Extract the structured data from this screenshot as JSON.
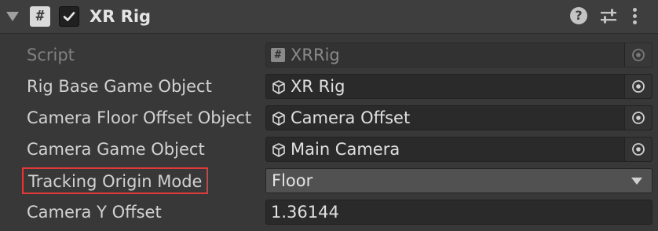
{
  "header": {
    "script_icon": "hash-icon",
    "script_glyph": "#",
    "enabled": true,
    "title": "XR Rig",
    "help_glyph": "?",
    "icons": [
      "help-icon",
      "presets-icon",
      "context-menu-icon"
    ]
  },
  "fields": [
    {
      "label": "Script",
      "value": "XRRig",
      "type": "script-reference",
      "disabled": true,
      "icon": "script-icon"
    },
    {
      "label": "Rig Base Game Object",
      "value": "XR Rig",
      "type": "object-reference",
      "icon": "gameobject-icon"
    },
    {
      "label": "Camera Floor Offset Object",
      "value": "Camera Offset",
      "type": "object-reference",
      "icon": "gameobject-icon"
    },
    {
      "label": "Camera Game Object",
      "value": "Main Camera",
      "type": "object-reference",
      "icon": "gameobject-icon"
    },
    {
      "label": "Tracking Origin Mode",
      "value": "Floor",
      "type": "dropdown",
      "highlighted": true
    },
    {
      "label": "Camera Y Offset",
      "value": "1.36144",
      "type": "float"
    }
  ],
  "colors": {
    "background": "#383838",
    "header_background": "#3e3e3e",
    "field_background": "#2a2a2a",
    "dropdown_background": "#515151",
    "highlight_border": "#e0393b",
    "text": "#d2d2d2"
  }
}
